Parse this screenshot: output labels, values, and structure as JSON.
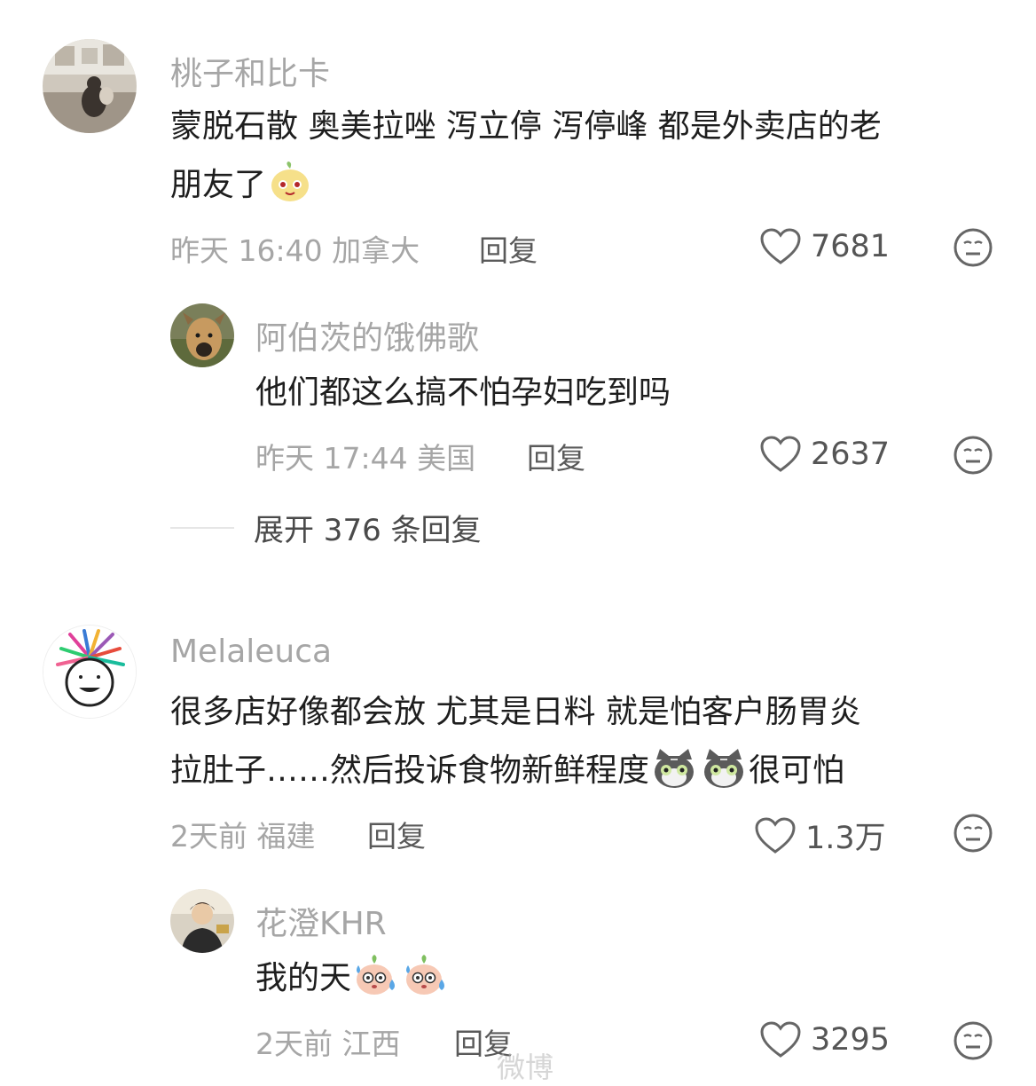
{
  "comments": [
    {
      "username": "桃子和比卡",
      "lines": [
        "蒙脱石散 奥美拉唑 泻立停 泻停峰 都是外卖店的老",
        "朋友了"
      ],
      "time": "昨天 16:40",
      "location": "加拿大",
      "reply_label": "回复",
      "likes": "7681",
      "reply": {
        "username": "阿伯茨的饿佛歌",
        "lines": [
          "他们都这么搞不怕孕妇吃到吗"
        ],
        "time": "昨天 17:44",
        "location": "美国",
        "reply_label": "回复",
        "likes": "2637"
      },
      "expand_label": "展开 376 条回复"
    },
    {
      "username": "Melaleuca",
      "lines": [
        "很多店好像都会放 尤其是日料 就是怕客户肠胃炎",
        "拉肚子……然后投诉食物新鲜程度",
        "很可怕"
      ],
      "time": "2天前",
      "location": "福建",
      "reply_label": "回复",
      "likes": "1.3万",
      "reply": {
        "username": "花澄KHR",
        "lines": [
          "我的天"
        ],
        "time": "2天前",
        "location": "江西",
        "reply_label": "回复",
        "likes": "3295"
      }
    }
  ],
  "icons": {
    "like": "heart-outline-icon",
    "dislike": "meh-face-icon",
    "emoji_1": "peach-smile-emoji",
    "emoji_2": "gray-cat-emoji",
    "emoji_3": "peach-sweat-emoji"
  },
  "watermark": "微博"
}
